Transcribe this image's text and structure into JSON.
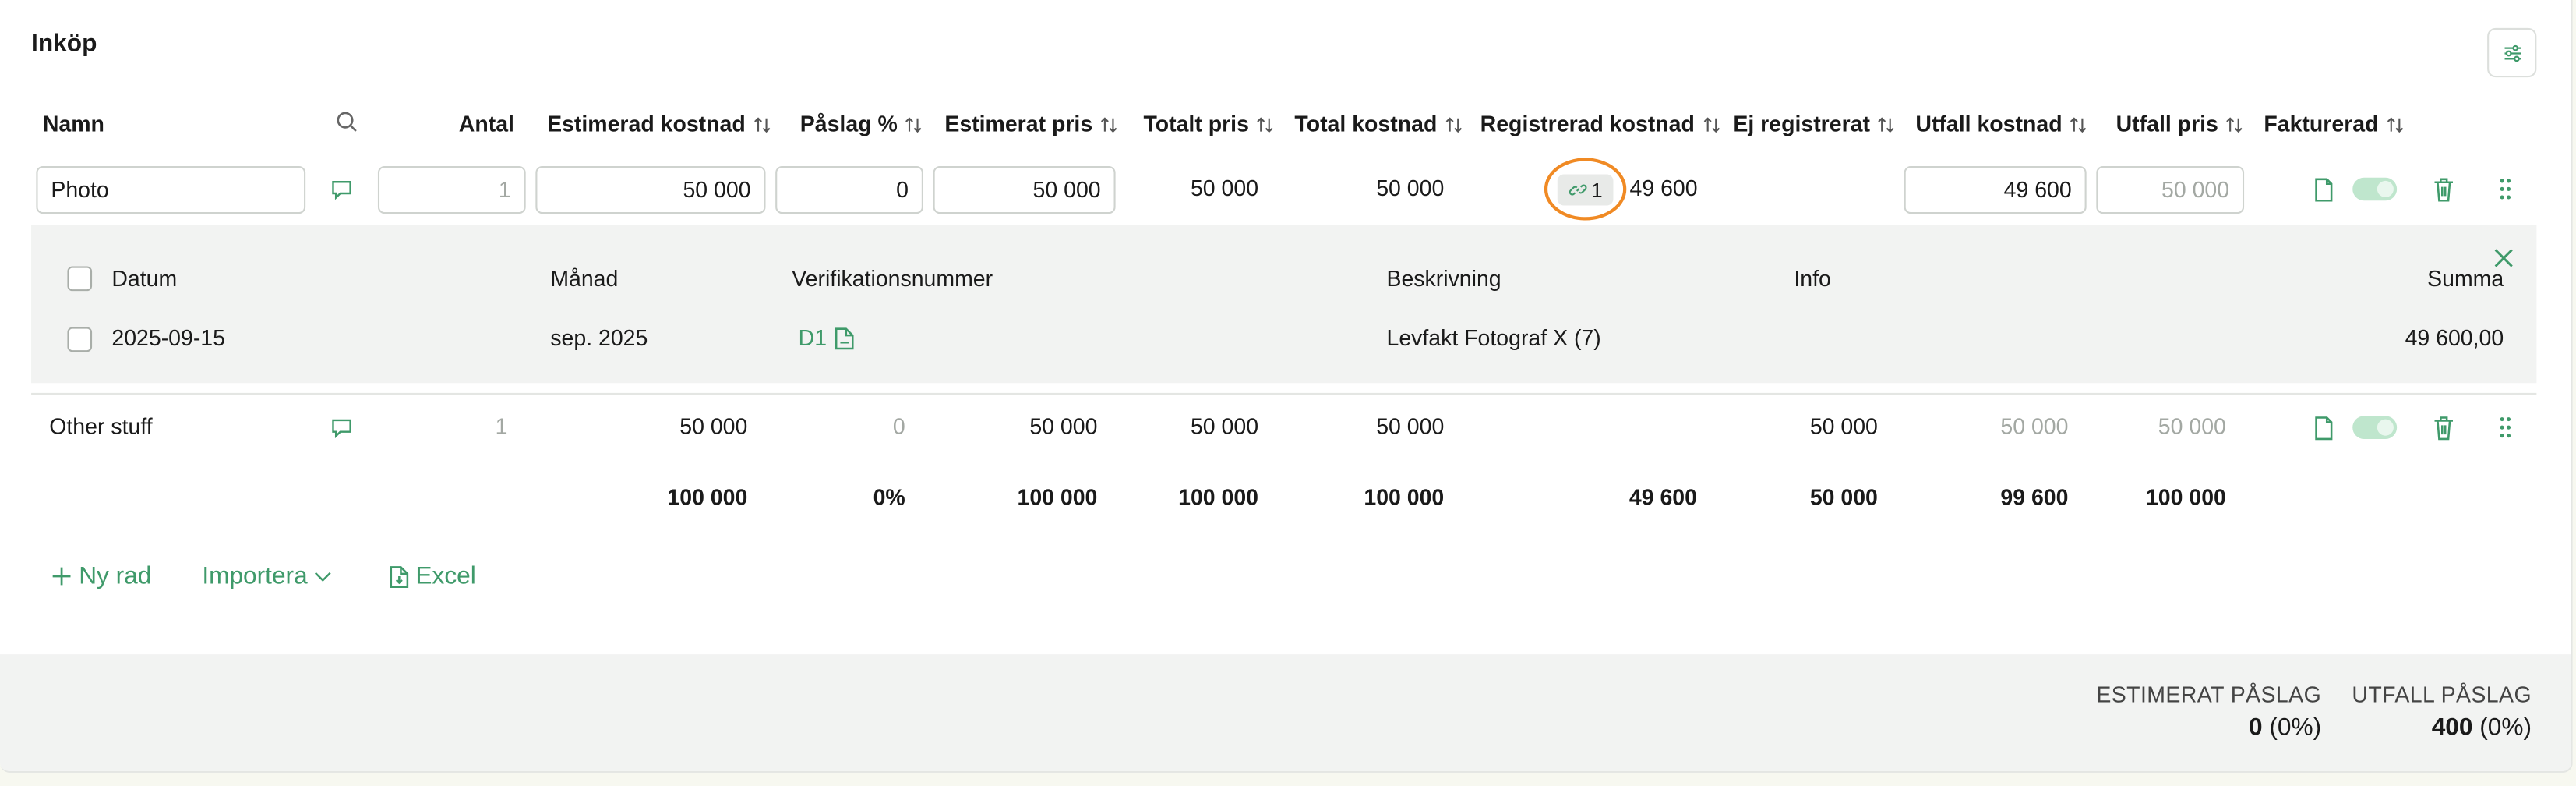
{
  "section_title": "Inköp",
  "columns": {
    "namn": "Namn",
    "antal": "Antal",
    "estimerad_kostnad": "Estimerad kostnad",
    "paslag": "Påslag %",
    "estimerat_pris": "Estimerat pris",
    "totalt_pris": "Totalt pris",
    "total_kostnad": "Total kostnad",
    "registrerad_kostnad": "Registrerad kostnad",
    "ej_registrerat": "Ej registrerat",
    "utfall_kostnad": "Utfall kostnad",
    "utfall_pris": "Utfall pris",
    "fakturerad": "Fakturerad"
  },
  "rows": [
    {
      "namn": "Photo",
      "antal_placeholder": "1",
      "estimerad_kostnad": "50 000",
      "paslag": "0",
      "estimerat_pris": "50 000",
      "totalt_pris": "50 000",
      "total_kostnad": "50 000",
      "linked_count": "1",
      "registrerad_kostnad": "49 600",
      "utfall_kostnad": "49 600",
      "utfall_pris_placeholder": "50 000",
      "fakturerad": true
    },
    {
      "namn": "Other stuff",
      "antal": "1",
      "estimerad_kostnad": "50 000",
      "paslag": "0",
      "estimerat_pris": "50 000",
      "totalt_pris": "50 000",
      "total_kostnad": "50 000",
      "ej_registrerat": "50 000",
      "utfall_kostnad": "50 000",
      "utfall_pris": "50 000",
      "fakturerad": true
    }
  ],
  "verifications": {
    "headers": {
      "datum": "Datum",
      "manad": "Månad",
      "verifikationsnummer": "Verifikationsnummer",
      "beskrivning": "Beskrivning",
      "info": "Info",
      "summa": "Summa"
    },
    "rows": [
      {
        "datum": "2025-09-15",
        "manad": "sep. 2025",
        "verifikationsnummer": "D1",
        "beskrivning": "Levfakt Fotograf X (7)",
        "info": "",
        "summa": "49 600,00"
      }
    ]
  },
  "totals": {
    "estimerad_kostnad": "100 000",
    "paslag": "0%",
    "estimerat_pris": "100 000",
    "totalt_pris": "100 000",
    "total_kostnad": "100 000",
    "registrerad_kostnad": "49 600",
    "ej_registrerat": "50 000",
    "utfall_kostnad": "99 600",
    "utfall_pris": "100 000"
  },
  "actions": {
    "ny_rad": "Ny rad",
    "importera": "Importera",
    "excel": "Excel"
  },
  "footer": {
    "estimerat_paslag_label": "ESTIMERAT PÅSLAG",
    "estimerat_paslag_value": "0",
    "estimerat_paslag_pct": "(0%)",
    "utfall_paslag_label": "UTFALL PÅSLAG",
    "utfall_paslag_value": "400",
    "utfall_paslag_pct": "(0%)"
  },
  "colors": {
    "accent": "#3f9a6a",
    "highlight": "#f08a24",
    "muted": "#a3a8a3"
  }
}
